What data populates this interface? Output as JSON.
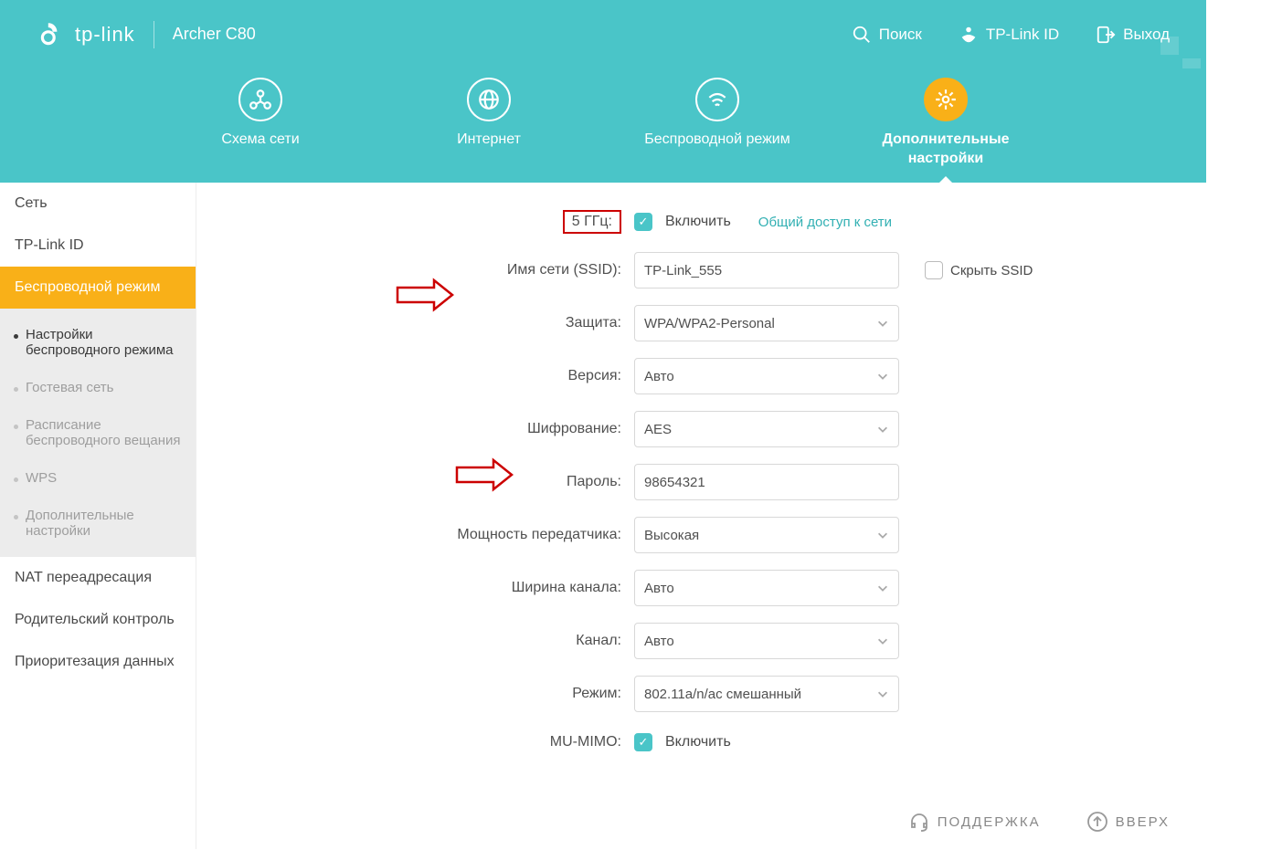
{
  "header": {
    "brand": "tp-link",
    "model": "Archer C80",
    "search": "Поиск",
    "tpid": "TP-Link ID",
    "logout": "Выход"
  },
  "tabs": {
    "map": "Схема сети",
    "internet": "Интернет",
    "wireless": "Беспроводной режим",
    "advanced": "Дополнительные настройки"
  },
  "sidebar": {
    "network": "Сеть",
    "tpid": "TP-Link ID",
    "wireless": "Беспроводной режим",
    "sub": {
      "settings": "Настройки беспроводного режима",
      "guest": "Гостевая сеть",
      "schedule": "Расписание беспроводного вещания",
      "wps": "WPS",
      "advanced": "Дополнительные настройки"
    },
    "nat": "NAT переадресация",
    "parental": "Родительский контроль",
    "qos": "Приоритезация данных"
  },
  "form": {
    "band": "5 ГГц:",
    "enable": "Включить",
    "share": "Общий доступ к сети",
    "ssid_label": "Имя сети (SSID):",
    "ssid": "TP-Link_555",
    "hide": "Скрыть SSID",
    "security_label": "Защита:",
    "security": "WPA/WPA2-Personal",
    "version_label": "Версия:",
    "version": "Авто",
    "encryption_label": "Шифрование:",
    "encryption": "AES",
    "password_label": "Пароль:",
    "password": "98654321",
    "txpower_label": "Мощность передатчика:",
    "txpower": "Высокая",
    "chwidth_label": "Ширина канала:",
    "chwidth": "Авто",
    "channel_label": "Канал:",
    "channel": "Авто",
    "mode_label": "Режим:",
    "mode": "802.11a/n/ac смешанный",
    "mumimo_label": "MU-MIMO:",
    "mumimo": "Включить"
  },
  "footer": {
    "support": "ПОДДЕРЖКА",
    "top": "ВВЕРХ"
  }
}
